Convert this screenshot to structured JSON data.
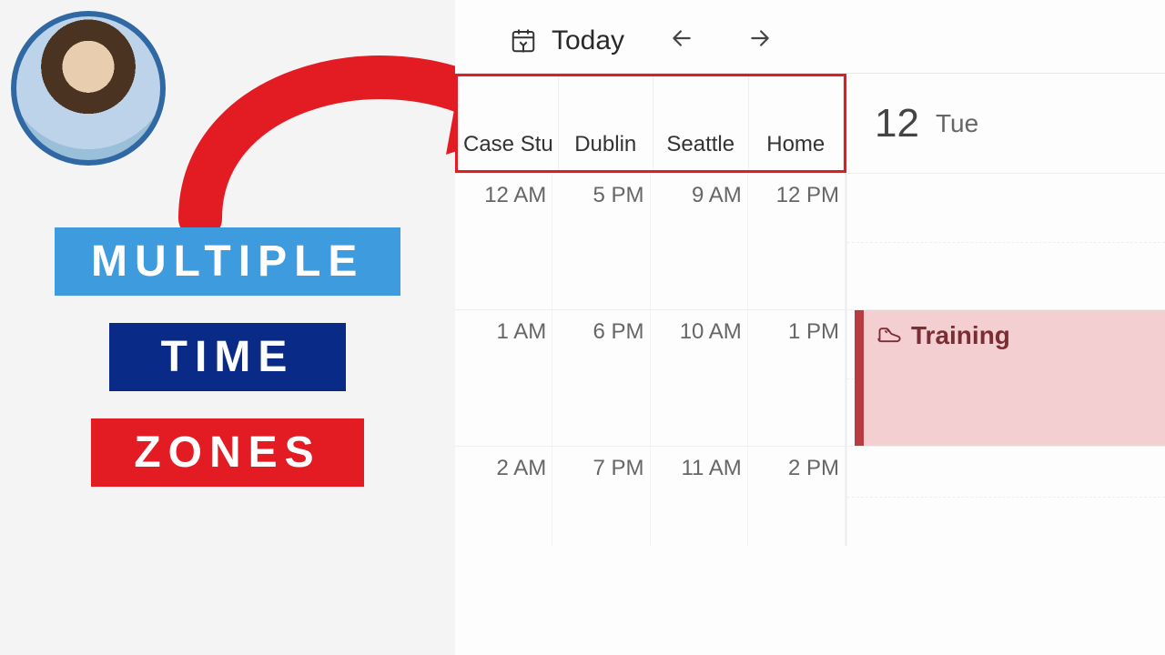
{
  "banner": {
    "line1": "MULTIPLE",
    "line2": "TIME",
    "line3": "ZONES"
  },
  "toolbar": {
    "today": "Today"
  },
  "timezones": {
    "col1": "Case Stu",
    "col2": "Dublin",
    "col3": "Seattle",
    "col4": "Home"
  },
  "date": {
    "num": "12",
    "day": "Tue"
  },
  "rows": [
    {
      "c1": "12 AM",
      "c2": "5 PM",
      "c3": "9 AM",
      "c4": "12 PM"
    },
    {
      "c1": "1 AM",
      "c2": "6 PM",
      "c3": "10 AM",
      "c4": "1 PM"
    },
    {
      "c1": "2 AM",
      "c2": "7 PM",
      "c3": "11 AM",
      "c4": "2 PM"
    }
  ],
  "event": {
    "title": "Training"
  }
}
